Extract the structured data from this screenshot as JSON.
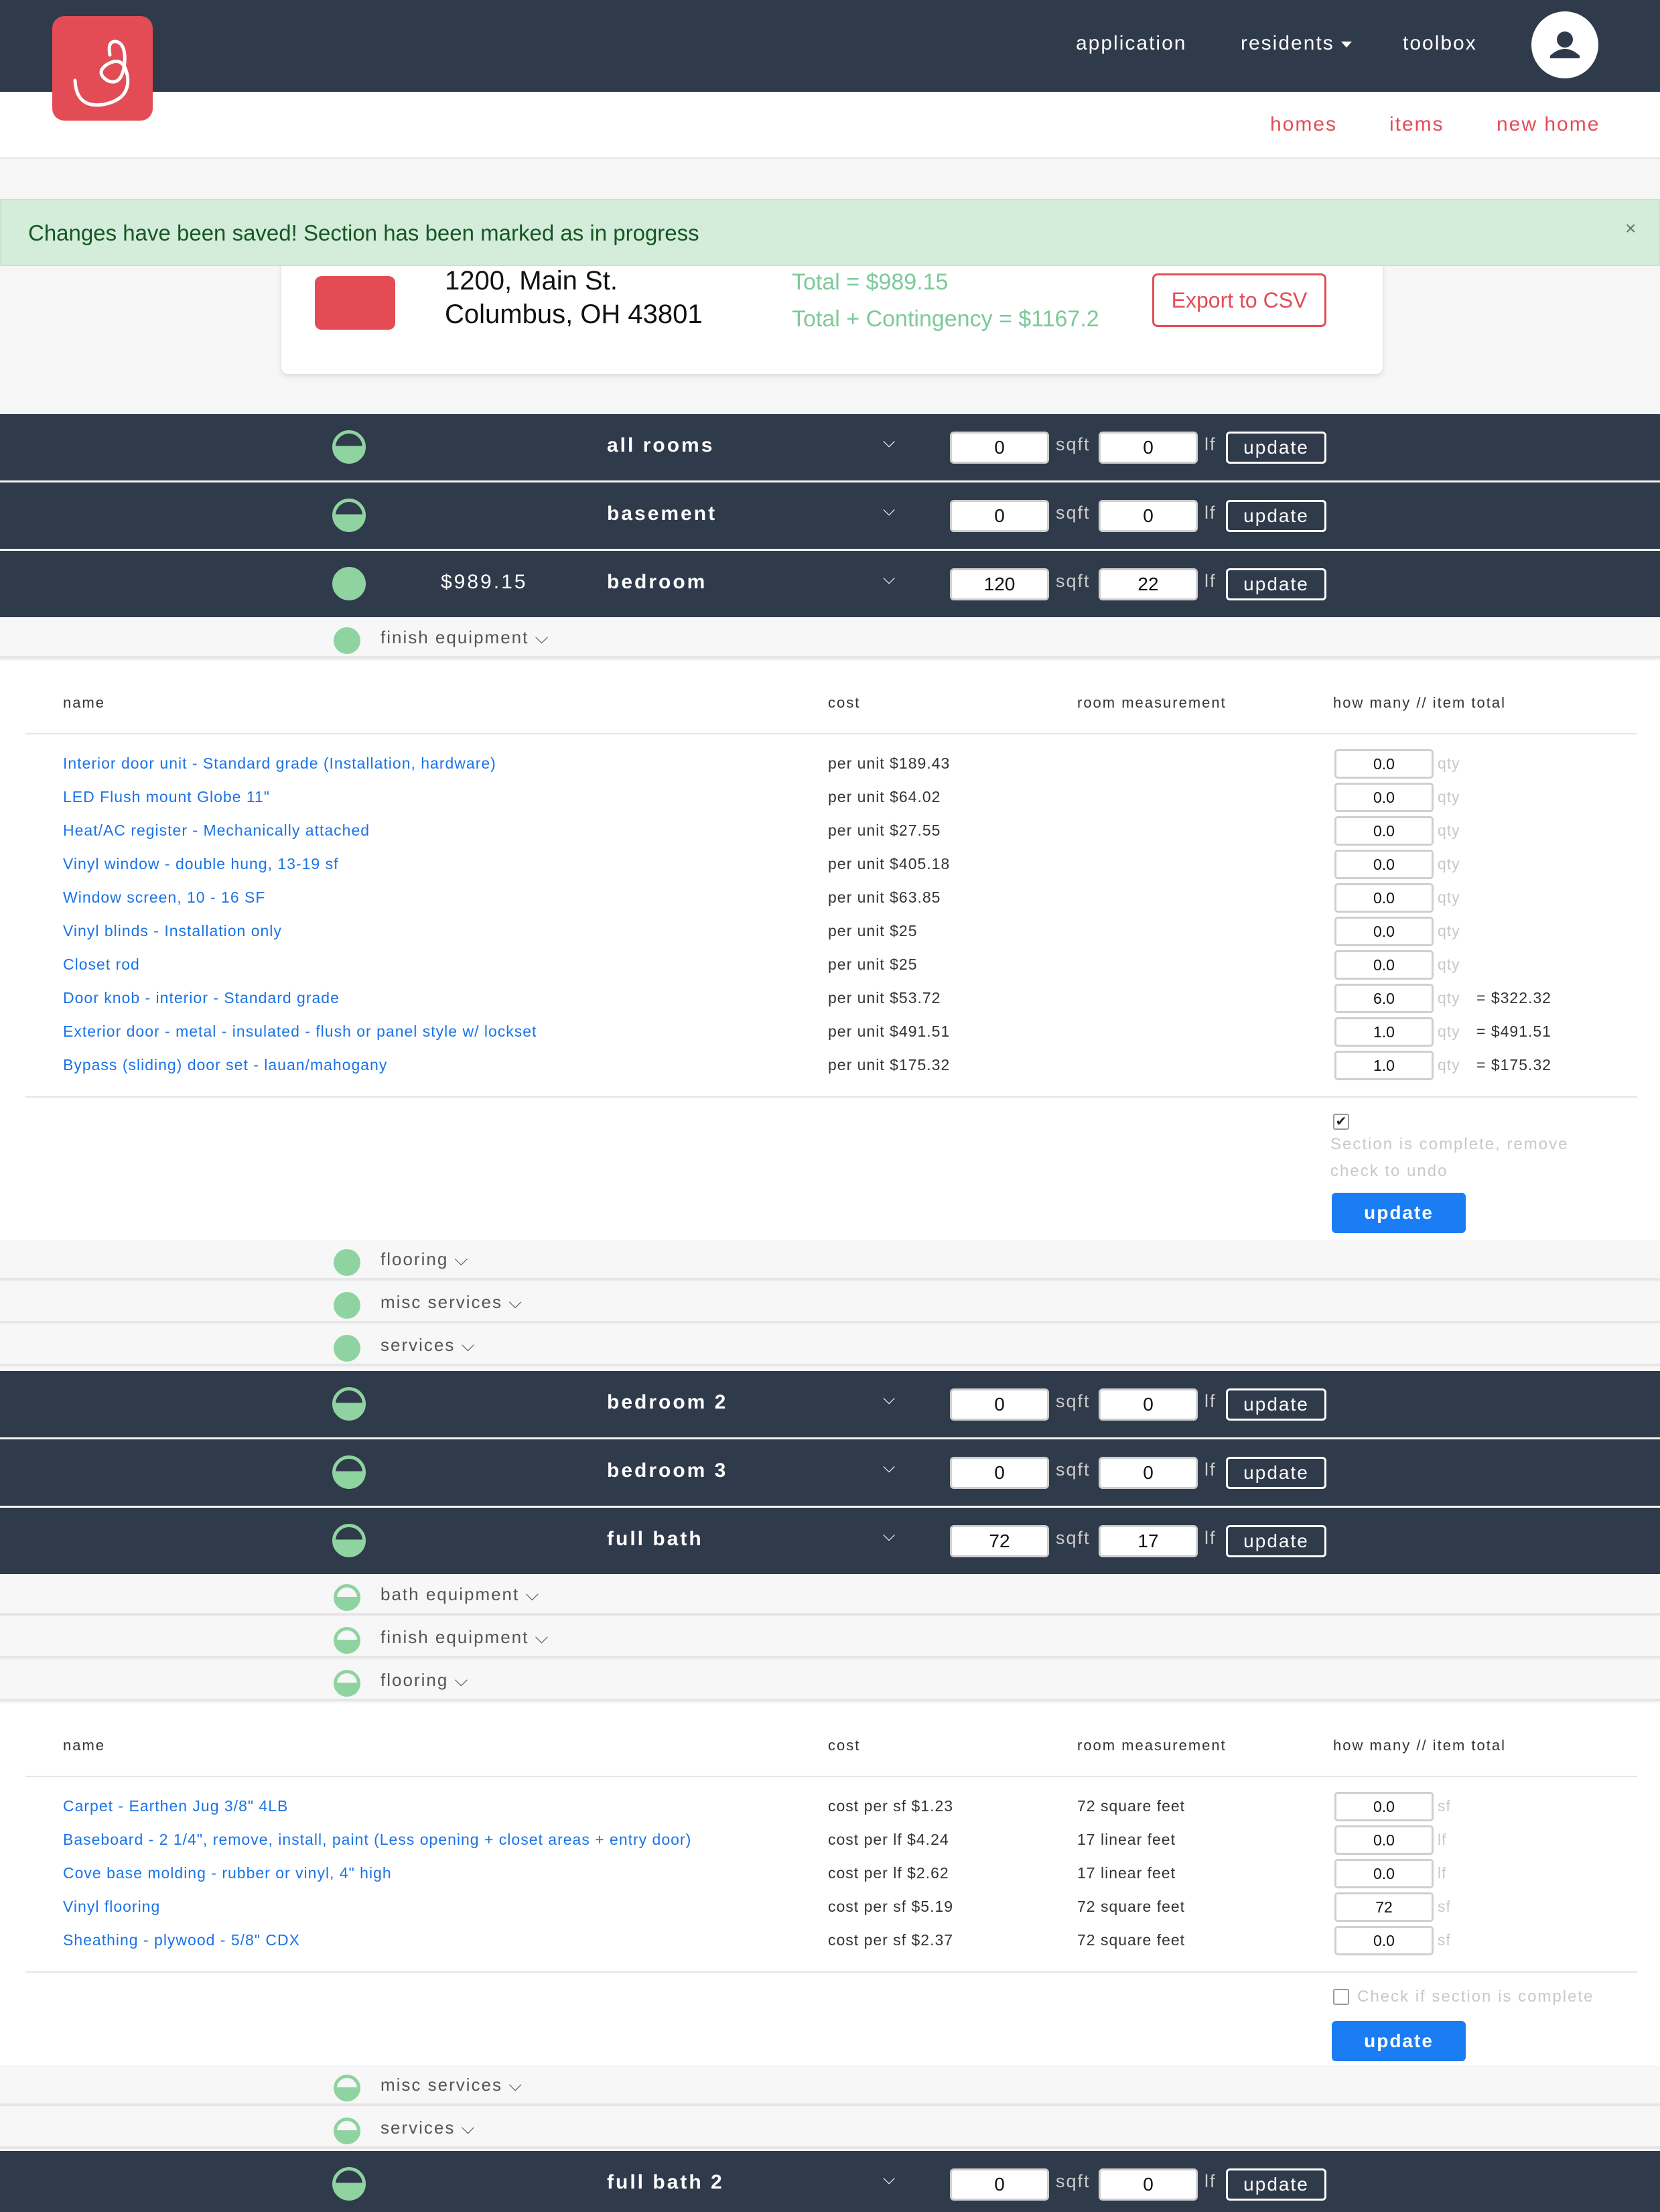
{
  "nav": {
    "links": [
      "application",
      "residents",
      "toolbox"
    ]
  },
  "subnav": {
    "links": [
      "homes",
      "items",
      "new home"
    ]
  },
  "alert": {
    "message": "Changes have been saved! Section has been marked as in progress",
    "close": "×"
  },
  "home": {
    "address_line1": "1200, Main St.",
    "address_line2": "Columbus, OH 43801",
    "total": "Total = $989.15",
    "total_contingency": "Total + Contingency = $1167.2",
    "export_label": "Export to CSV"
  },
  "labels": {
    "sqft": "sqft",
    "lf": "lf",
    "update": "update",
    "qty": "qty",
    "sf": "sf",
    "lf_unit": "lf"
  },
  "rooms": [
    {
      "name": "all rooms",
      "total": "",
      "sqft": "0",
      "lf": "0",
      "status": "in-progress"
    },
    {
      "name": "basement",
      "total": "",
      "sqft": "0",
      "lf": "0",
      "status": "in-progress"
    },
    {
      "name": "bedroom",
      "total": "$989.15",
      "sqft": "120",
      "lf": "22",
      "status": "complete"
    },
    {
      "name": "bedroom 2",
      "total": "",
      "sqft": "0",
      "lf": "0",
      "status": "in-progress"
    },
    {
      "name": "bedroom 3",
      "total": "",
      "sqft": "0",
      "lf": "0",
      "status": "in-progress"
    },
    {
      "name": "full bath",
      "total": "",
      "sqft": "72",
      "lf": "17",
      "status": "in-progress"
    },
    {
      "name": "full bath 2",
      "total": "",
      "sqft": "0",
      "lf": "0",
      "status": "in-progress"
    }
  ],
  "bedroom_categories": [
    {
      "name": "finish equipment",
      "status": "complete"
    },
    {
      "name": "flooring",
      "status": "complete"
    },
    {
      "name": "misc services",
      "status": "complete"
    },
    {
      "name": "services",
      "status": "complete"
    }
  ],
  "fullbath_categories": [
    {
      "name": "bath equipment",
      "status": "in-progress"
    },
    {
      "name": "finish equipment",
      "status": "in-progress"
    },
    {
      "name": "flooring",
      "status": "in-progress"
    },
    {
      "name": "misc services",
      "status": "in-progress"
    },
    {
      "name": "services",
      "status": "in-progress"
    }
  ],
  "table_headers": [
    "name",
    "cost",
    "room measurement",
    "how many // item total"
  ],
  "finish_items": [
    {
      "name": "Interior door unit - Standard grade (Installation, hardware)",
      "cost": "per unit $189.43",
      "qty": "0.0",
      "total": ""
    },
    {
      "name": "LED Flush mount Globe 11\"",
      "cost": "per unit $64.02",
      "qty": "0.0",
      "total": ""
    },
    {
      "name": "Heat/AC register - Mechanically attached",
      "cost": "per unit $27.55",
      "qty": "0.0",
      "total": ""
    },
    {
      "name": "Vinyl window - double hung, 13-19 sf",
      "cost": "per unit $405.18",
      "qty": "0.0",
      "total": ""
    },
    {
      "name": "Window screen, 10 - 16 SF",
      "cost": "per unit $63.85",
      "qty": "0.0",
      "total": ""
    },
    {
      "name": "Vinyl blinds - Installation only",
      "cost": "per unit $25",
      "qty": "0.0",
      "total": ""
    },
    {
      "name": "Closet rod",
      "cost": "per unit $25",
      "qty": "0.0",
      "total": ""
    },
    {
      "name": "Door knob - interior - Standard grade",
      "cost": "per unit $53.72",
      "qty": "6.0",
      "total": "= $322.32"
    },
    {
      "name": "Exterior door - metal - insulated - flush or panel style w/ lockset",
      "cost": "per unit $491.51",
      "qty": "1.0",
      "total": "= $491.51"
    },
    {
      "name": "Bypass (sliding) door set - lauan/mahogany",
      "cost": "per unit $175.32",
      "qty": "1.0",
      "total": "= $175.32"
    }
  ],
  "finish_complete": {
    "checked": true,
    "label": "Section is complete, remove check to undo",
    "update": "update"
  },
  "flooring_items": [
    {
      "name": "Carpet - Earthen Jug 3/8\" 4LB",
      "cost": "cost per sf $1.23",
      "measurement": "72 square feet",
      "qty": "0.0",
      "unit": "sf"
    },
    {
      "name": "Baseboard - 2 1/4\", remove, install, paint (Less opening + closet areas + entry door)",
      "cost": "cost per lf $4.24",
      "measurement": "17 linear feet",
      "qty": "0.0",
      "unit": "lf"
    },
    {
      "name": "Cove base molding - rubber or vinyl, 4\" high",
      "cost": "cost per lf $2.62",
      "measurement": "17 linear feet",
      "qty": "0.0",
      "unit": "lf"
    },
    {
      "name": "Vinyl flooring",
      "cost": "cost per sf $5.19",
      "measurement": "72 square feet",
      "qty": "72",
      "unit": "sf"
    },
    {
      "name": "Sheathing - plywood - 5/8\" CDX",
      "cost": "cost per sf $2.37",
      "measurement": "72 square feet",
      "qty": "0.0",
      "unit": "sf"
    }
  ],
  "flooring_complete": {
    "checked": false,
    "label": "Check if section is complete",
    "update": "update"
  },
  "colors": {
    "navbar": "#2f3a4a",
    "brand": "#e34c55",
    "status_green": "#8fd3a0",
    "link_blue": "#1a73e8",
    "button_blue": "#1a7df3"
  },
  "icons": [
    "app-logo-icon",
    "user-avatar-icon",
    "house-icon",
    "status-circle-icon",
    "chevron-down-icon"
  ]
}
